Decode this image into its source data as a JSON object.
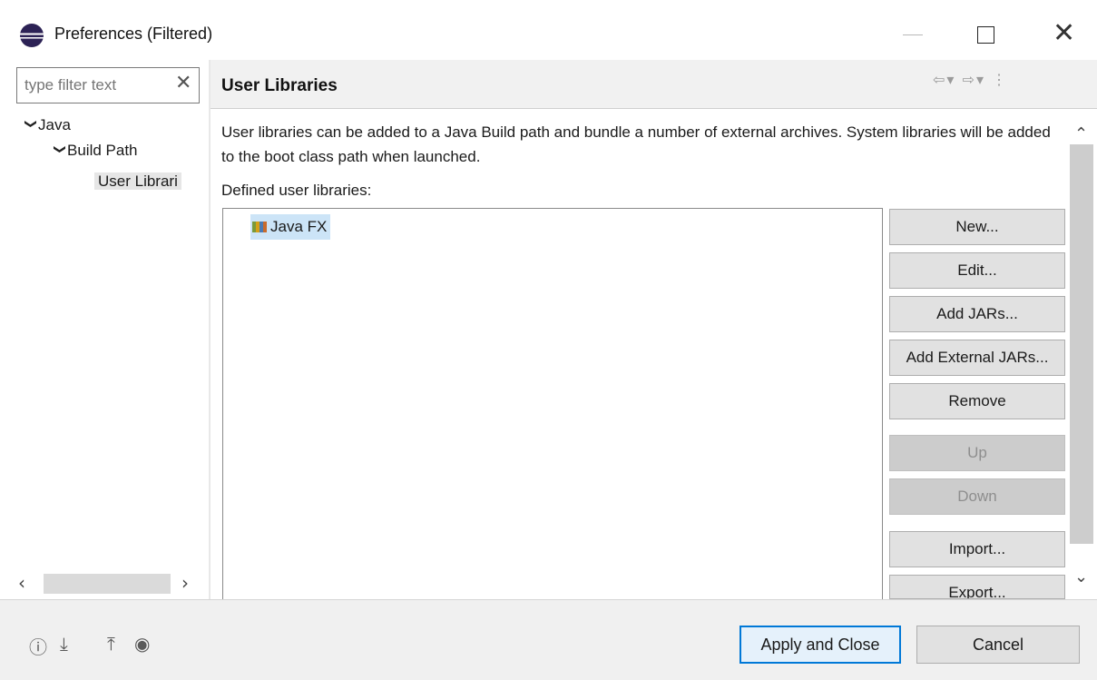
{
  "window": {
    "title": "Preferences (Filtered)",
    "close_glyph": "✕"
  },
  "sidebar": {
    "filter_placeholder": "type filter text",
    "tree": [
      {
        "label": "Java",
        "arrow": "❯"
      },
      {
        "label": "Build Path",
        "arrow": "❯"
      },
      {
        "label": "User Librari"
      }
    ]
  },
  "page": {
    "title": "User Libraries",
    "description": "User libraries can be added to a Java Build path and bundle a number of external archives. System libraries will be added to the boot class path when launched.",
    "defined_label": "Defined user libraries:",
    "libraries": [
      {
        "name": "Java FX",
        "selected": true
      }
    ],
    "buttons": {
      "new": "New...",
      "edit": "Edit...",
      "add_jars": "Add JARs...",
      "add_external_jars": "Add External JARs...",
      "remove": "Remove",
      "up": "Up",
      "down": "Down",
      "import": "Import...",
      "export": "Export..."
    }
  },
  "footer": {
    "apply_close": "Apply and Close",
    "cancel": "Cancel"
  },
  "colors": {
    "selection": "#cce4f7",
    "default_button_border": "#0078d7"
  }
}
